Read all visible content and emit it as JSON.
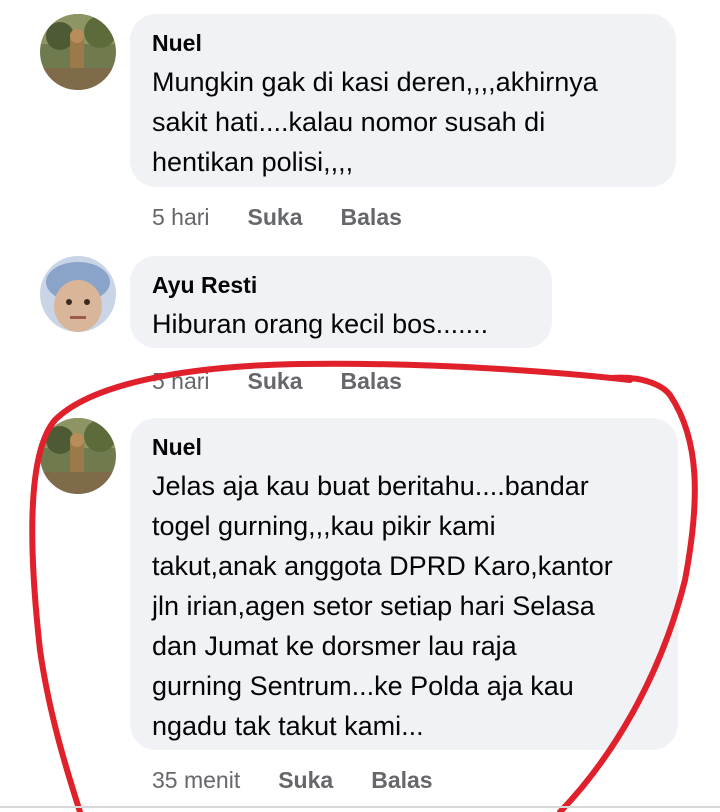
{
  "comments": [
    {
      "author": "Nuel",
      "text": "Mungkin gak di kasi deren,,,,akhirnya\nsakit hati....kalau nomor susah di\nhentikan polisi,,,,",
      "time": "5 hari",
      "like": "Suka",
      "reply": "Balas"
    },
    {
      "author": "Ayu Resti",
      "text": "Hiburan orang kecil bos.......",
      "time": "5 hari",
      "like": "Suka",
      "reply": "Balas"
    },
    {
      "author": "Nuel",
      "text": "Jelas aja kau buat beritahu....bandar\ntogel gurning,,,kau pikir kami\ntakut,anak anggota DPRD Karo,kantor\njln irian,agen setor setiap hari Selasa\ndan Jumat ke dorsmer lau raja\ngurning Sentrum...ke Polda aja kau\nngadu tak takut kami...",
      "time": "35 menit",
      "like": "Suka",
      "reply": "Balas"
    }
  ],
  "annotation": {
    "color": "#e0202a"
  }
}
